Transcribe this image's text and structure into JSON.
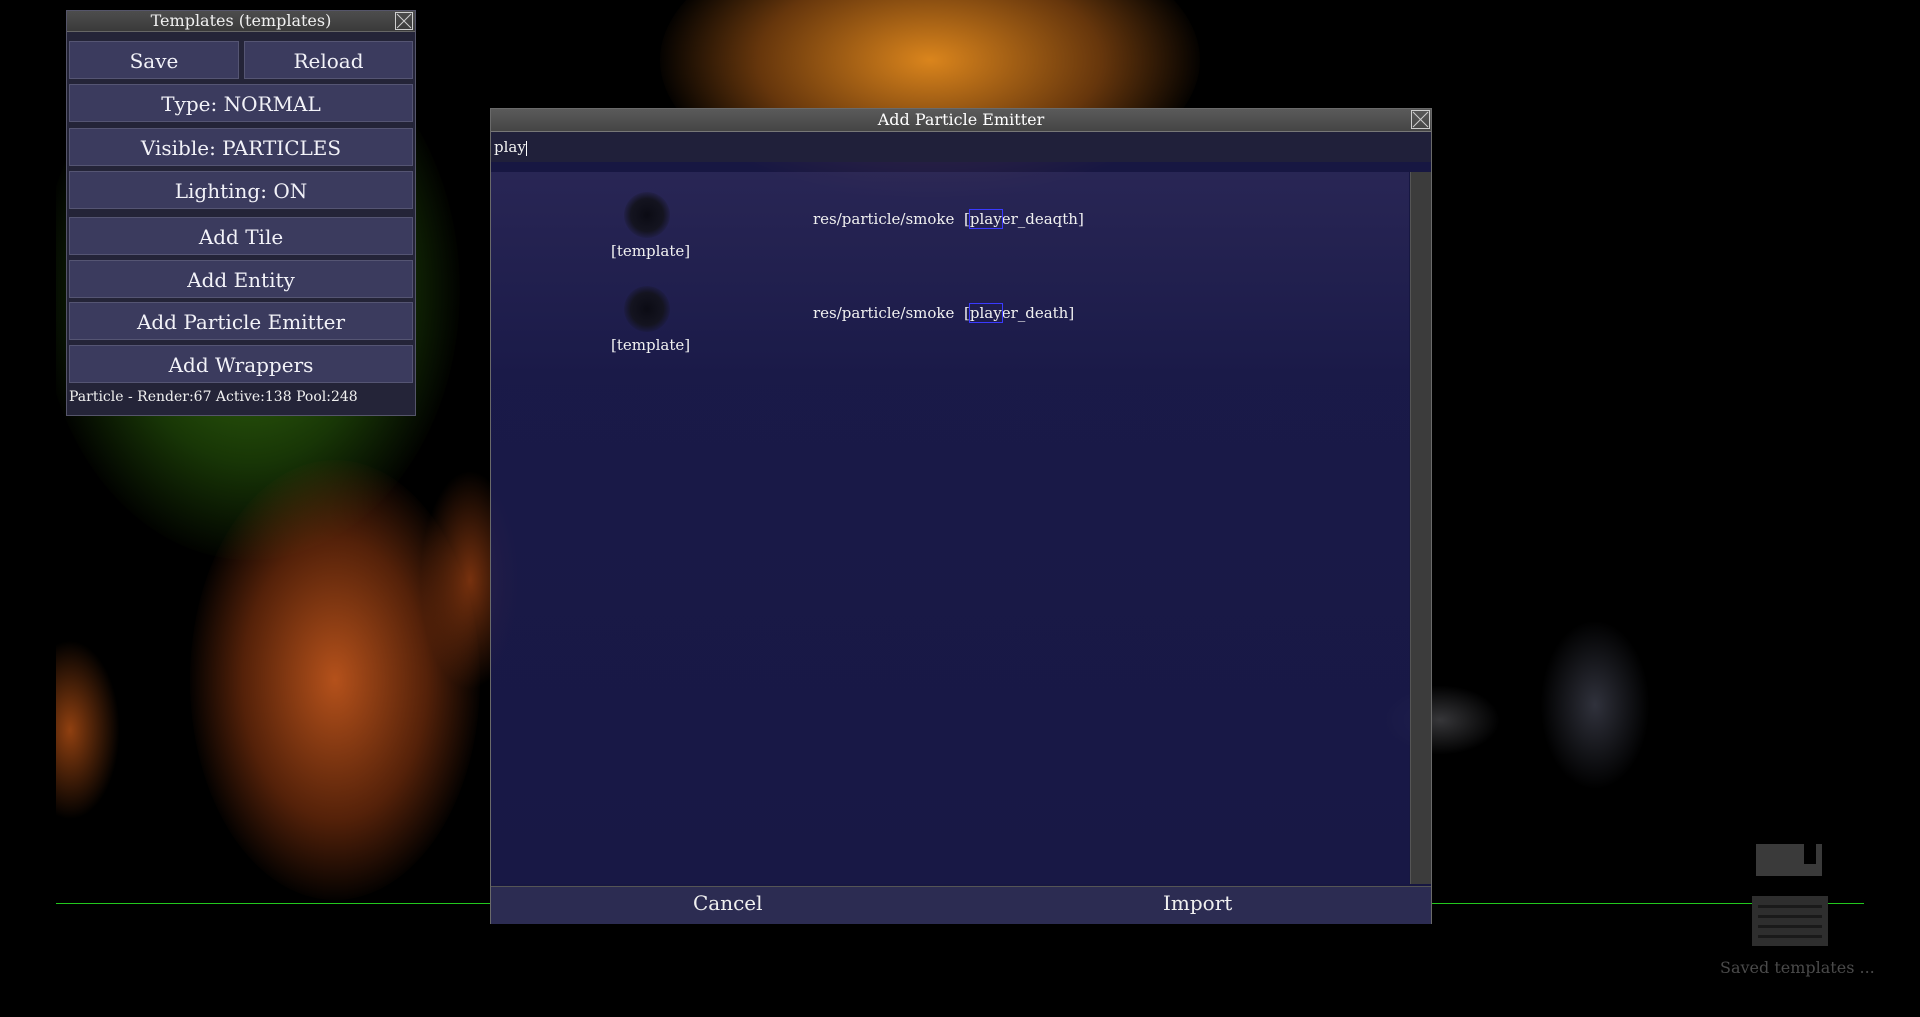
{
  "templates_window": {
    "title": "Templates (templates)",
    "save_label": "Save",
    "reload_label": "Reload",
    "type_label": "Type: NORMAL",
    "visible_label": "Visible: PARTICLES",
    "lighting_label": "Lighting: ON",
    "add_tile_label": "Add Tile",
    "add_entity_label": "Add Entity",
    "add_particle_emitter_label": "Add Particle Emitter",
    "add_wrappers_label": "Add Wrappers",
    "status": "Particle  -  Render:67  Active:138  Pool:248"
  },
  "dialog": {
    "title": "Add Particle Emitter",
    "search_value": "play",
    "results": [
      {
        "thumb_label": "[template]",
        "path": "res/particle/smoke",
        "name_open": "[",
        "name_match": "play",
        "name_rest": "er_deaqth]"
      },
      {
        "thumb_label": "[template]",
        "path": "res/particle/smoke",
        "name_open": "[",
        "name_match": "play",
        "name_rest": "er_death]"
      }
    ],
    "cancel_label": "Cancel",
    "import_label": "Import"
  },
  "saved_templates": {
    "label": "Saved templates ..."
  },
  "icons": {
    "close": "close-icon",
    "save": "save-icon",
    "list": "list-icon"
  },
  "colors": {
    "ground_line": "#22c81e",
    "dialog_bg": "#1c1c50",
    "button_bg": "#3b3b5e"
  }
}
